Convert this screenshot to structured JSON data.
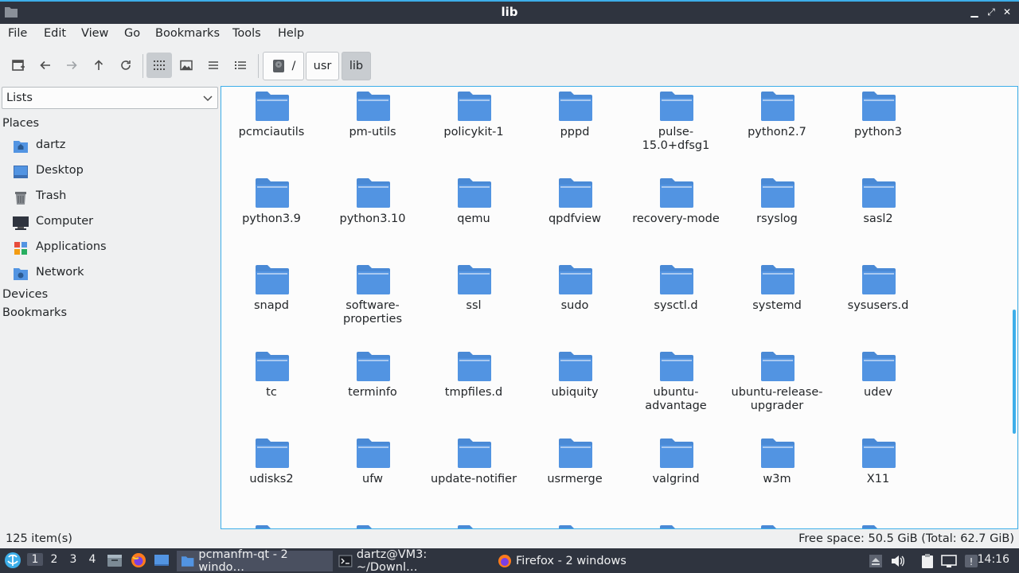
{
  "window": {
    "title": "lib"
  },
  "menu": [
    "File",
    "Edit",
    "View",
    "Go",
    "Bookmarks",
    "Tools",
    "Help"
  ],
  "path": {
    "root": "/",
    "segments": [
      "usr",
      "lib"
    ]
  },
  "sidebar": {
    "mode": "Lists",
    "places_label": "Places",
    "places": [
      {
        "label": "dartz",
        "icon": "home-folder-icon"
      },
      {
        "label": "Desktop",
        "icon": "desktop-icon"
      },
      {
        "label": "Trash",
        "icon": "trash-icon"
      },
      {
        "label": "Computer",
        "icon": "computer-icon"
      },
      {
        "label": "Applications",
        "icon": "applications-icon"
      },
      {
        "label": "Network",
        "icon": "network-icon"
      }
    ],
    "devices_label": "Devices",
    "bookmarks_label": "Bookmarks"
  },
  "folders": [
    "pcmciautils",
    "pm-utils",
    "policykit-1",
    "pppd",
    "pulse-15.0+dfsg1",
    "python2.7",
    "python3",
    "python3.9",
    "python3.10",
    "qemu",
    "qpdfview",
    "recovery-mode",
    "rsyslog",
    "sasl2",
    "snapd",
    "software-\nproperties",
    "ssl",
    "sudo",
    "sysctl.d",
    "systemd",
    "sysusers.d",
    "tc",
    "terminfo",
    "tmpfiles.d",
    "ubiquity",
    "ubuntu-\nadvantage",
    "ubuntu-release-\nupgrader",
    "udev",
    "udisks2",
    "ufw",
    "update-notifier",
    "usrmerge",
    "valgrind",
    "w3m",
    "X11"
  ],
  "status": {
    "items": "125 item(s)",
    "free": "Free space: 50.5 GiB (Total: 62.7 GiB)"
  },
  "taskbar": {
    "workspaces": [
      "1",
      "2",
      "3",
      "4"
    ],
    "tasks": [
      {
        "label": "pcmanfm-qt - 2 windo…",
        "icon": "folder-icon"
      },
      {
        "label": "dartz@VM3: ~/Downl…",
        "icon": "terminal-icon"
      },
      {
        "label": "Firefox - 2 windows",
        "icon": "firefox-icon"
      }
    ],
    "clock": "14:16"
  },
  "colors": {
    "accent": "#3daee9",
    "folder": "#5294e2",
    "dark": "#2f343f"
  }
}
